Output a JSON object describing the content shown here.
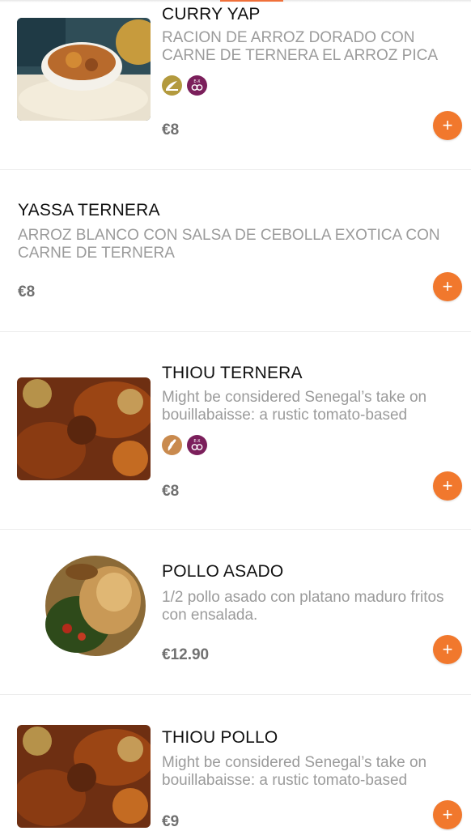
{
  "menu": {
    "items": [
      {
        "name": "CURRY YAP",
        "description": "RACION DE ARROZ DORADO CON CARNE DE TERNERA EL ARROZ PICA",
        "price": "€8",
        "image": "curry-rice-bowl",
        "badges": [
          "gluten-icon",
          "egg-allergen-icon"
        ],
        "badge_text": [
          "",
          "E-X"
        ]
      },
      {
        "name": "YASSA TERNERA",
        "description": "ARROZ BLANCO CON SALSA DE CEBOLLA EXOTICA CON CARNE DE TERNERA",
        "price": "€8",
        "image": null,
        "badges": []
      },
      {
        "name": "THIOU TERNERA",
        "description": "Might be considered Senegal’s take on bouillabaisse: a rustic tomato-based",
        "price": "€8",
        "image": "beef-stew",
        "badges": [
          "wheat-icon",
          "egg-allergen-icon"
        ],
        "badge_text": [
          "",
          "E-X"
        ]
      },
      {
        "name": "POLLO ASADO",
        "description": "1/2 pollo asado con platano maduro fritos con ensalada.",
        "price": "€12.90",
        "image": "roast-chicken",
        "badges": []
      },
      {
        "name": "THIOU POLLO",
        "description": "Might be considered Senegal’s take on bouillabaisse: a rustic tomato-based",
        "price": "€9",
        "image": "chicken-stew",
        "badges": []
      }
    ],
    "add_label": "+"
  },
  "colors": {
    "accent": "#f1782d",
    "gluten_badge": "#b39a3e",
    "wheat_badge": "#c98a4e",
    "egg_badge": "#7b1f5b"
  }
}
